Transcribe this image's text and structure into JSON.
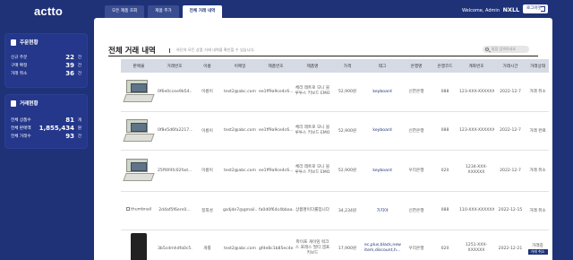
{
  "header": {
    "logo": "actto",
    "tabs": [
      {
        "label": "모든 제품 조회",
        "active": false
      },
      {
        "label": "제품 추가",
        "active": false
      },
      {
        "label": "전체 거래 내역",
        "active": true
      }
    ],
    "welcome_prefix": "Welcome, Admin",
    "welcome_name": "NXLL",
    "logout_label": "로그아웃"
  },
  "order_panel": {
    "title": "주문현황",
    "rows": [
      {
        "label": "신규 주문",
        "value": "22",
        "unit": "건"
      },
      {
        "label": "구매 확정",
        "value": "39",
        "unit": "건"
      },
      {
        "label": "거래 취소",
        "value": "36",
        "unit": "건"
      }
    ]
  },
  "trade_panel": {
    "title": "거래현황",
    "rows": [
      {
        "label": "전체 상품수",
        "value": "81",
        "unit": "개"
      },
      {
        "label": "전체 판매액",
        "value": "1,855,434",
        "unit": "원"
      },
      {
        "label": "전체 거래수",
        "value": "93",
        "unit": "건"
      }
    ]
  },
  "main": {
    "title": "전체 거래 내역",
    "hint": "하단의 모든 상품 거래 내역을 확인할 수 있습니다.",
    "search_placeholder": "통합 검색하세요"
  },
  "table": {
    "columns": [
      "판매물",
      "거래번호",
      "이름",
      "이메일",
      "제품번호",
      "제품명",
      "가격",
      "태그",
      "은행명",
      "은행코드",
      "계좌번호",
      "거래시간",
      "거래상태"
    ],
    "rows": [
      {
        "order": "0f6e0ccee9b54...",
        "name": "이름이",
        "email": "test2@abc.com",
        "product_no": "ee1ff9a9ce4c6...",
        "product": "체리 레트로 모니 블루투스 키보드 EMO",
        "price": "52,900원",
        "tag": "keyboard",
        "bank": "신한은행",
        "code": "088",
        "account": "123-XXX-XXXXXX",
        "time": "2022-12-7",
        "status": "거래 취소"
      },
      {
        "order": "0f8e5d6fa2217...",
        "name": "이름이",
        "email": "test2@abc.com",
        "product_no": "ee1ff9a9ce4c6...",
        "product": "체리 레트로 모니 블루투스 키보드 EMO",
        "price": "52,900원",
        "tag": "keyboard",
        "bank": "신한은행",
        "code": "088",
        "account": "123-XXX-XXXXXX",
        "time": "2022-12-7",
        "status": "거래 완료"
      },
      {
        "order": "25ff4f4fc02fad...",
        "name": "이름이",
        "email": "test2@abc.com",
        "product_no": "ee1ff9a9ce4c6...",
        "product": "체리 레트로 모니 블루투스 키보드 EMO",
        "price": "52,900원",
        "tag": "keyboard",
        "bank": "우리은행",
        "code": "020",
        "account": "1234-XXX-XXXXXX",
        "time": "2022-12-7",
        "status": "거래 취소"
      },
      {
        "order": "2d4af5f6ern0...",
        "name": "정희성",
        "email": "gsdjde7@gmail...",
        "product_no": "fa0d0f64c4bbaa...",
        "product": "상품명이다롤입니다",
        "price": "34,234원",
        "tag": "가지야",
        "bank": "신한은행",
        "code": "088",
        "account": "110-XXX-XXXXXX",
        "time": "2022-12-15",
        "status": "거래 취소"
      },
      {
        "order": "3b5cdmhdfa0c5...",
        "name": "개를",
        "email": "test2@abc.com",
        "product_no": "gfde8c1b85ec4e...",
        "product": "파이프 게이밍 워크 스 프레스 멀티 앰프 키보드",
        "price": "17,900원",
        "tag": "ec,plus,black,new-item,discount,h...",
        "bank": "우리은행",
        "code": "020",
        "account": "1251-XXX-XXXXXX",
        "time": "2022-12-21",
        "status": "거래중"
      }
    ]
  },
  "thumbnail_alt": "thumbnail",
  "status_button": "거래 취소"
}
